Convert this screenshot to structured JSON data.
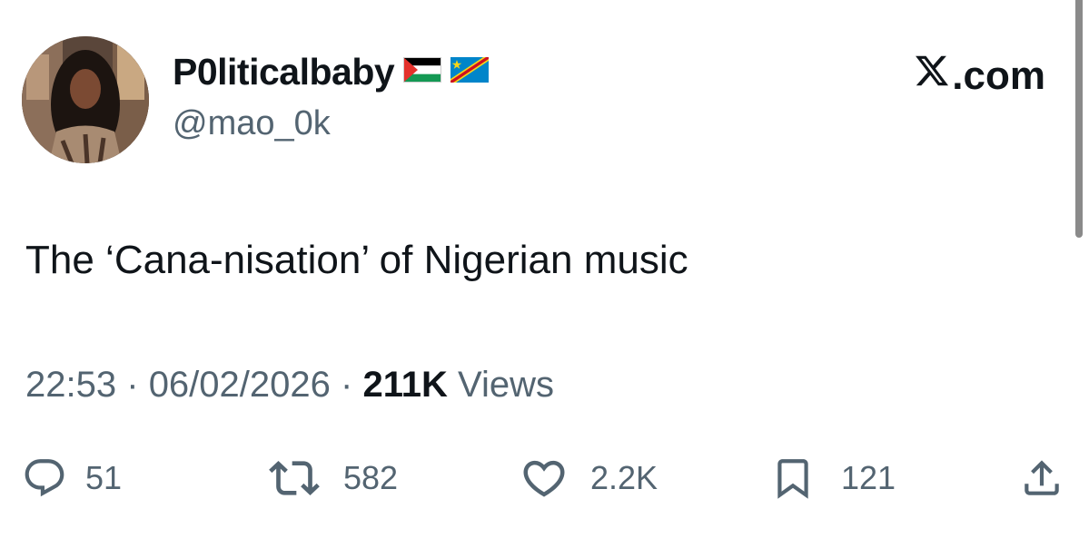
{
  "profile": {
    "display_name": "P0liticalbaby",
    "handle": "@mao_0k",
    "flags": [
      "palestine-flag-icon",
      "dr-congo-flag-icon"
    ]
  },
  "brand": {
    "label": ".com",
    "icon": "x-logo-icon"
  },
  "tweet": {
    "text": "The ‘Cana-nisation’ of Nigerian music",
    "time": "22:53",
    "separator": "·",
    "date": "06/02/2026",
    "views_count": "211K",
    "views_label": "Views"
  },
  "actions": {
    "replies": {
      "icon": "reply-icon",
      "count": "51"
    },
    "reposts": {
      "icon": "repost-icon",
      "count": "582"
    },
    "likes": {
      "icon": "heart-icon",
      "count": "2.2K"
    },
    "bookmarks": {
      "icon": "bookmark-icon",
      "count": "121"
    },
    "share": {
      "icon": "share-icon"
    }
  },
  "colors": {
    "text_primary": "#0f1419",
    "text_secondary": "#536471",
    "background": "#ffffff"
  }
}
